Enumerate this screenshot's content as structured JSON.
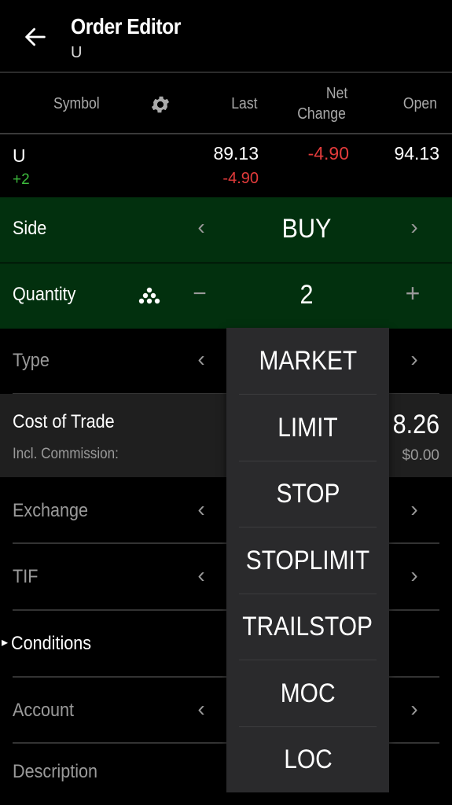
{
  "header": {
    "title": "Order Editor",
    "subtitle": "U",
    "back_icon": "arrow-left-icon"
  },
  "quote": {
    "columns": {
      "symbol": "Symbol",
      "settings_icon": "gear-icon",
      "last": "Last",
      "net_change_line1": "Net",
      "net_change_line2": "Change",
      "open": "Open"
    },
    "row": {
      "symbol": "U",
      "position": "+2",
      "last": "89.13",
      "last_change": "-4.90",
      "net_change": "-4.90",
      "open": "94.13"
    }
  },
  "form": {
    "side": {
      "label": "Side",
      "value": "BUY"
    },
    "quantity": {
      "label": "Quantity",
      "value": "2",
      "minus": "−",
      "plus": "+"
    },
    "type": {
      "label": "Type"
    },
    "cost": {
      "label": "Cost of Trade",
      "sublabel": "Incl. Commission:",
      "value_partial": "8.26",
      "commission": "$0.00"
    },
    "exchange": {
      "label": "Exchange"
    },
    "tif": {
      "label": "TIF"
    },
    "conditions": {
      "label": "Conditions",
      "icon": "▸"
    },
    "account": {
      "label": "Account"
    },
    "description": {
      "label": "Description"
    }
  },
  "chevrons": {
    "left": "‹",
    "right": "›"
  },
  "type_dropdown": {
    "options": [
      "MARKET",
      "LIMIT",
      "STOP",
      "STOPLIMIT",
      "TRAILSTOP",
      "MOC",
      "LOC"
    ]
  },
  "colors": {
    "accent_green_bg": "#02300e",
    "negative": "#e23b3b",
    "positive": "#3dbb3d"
  }
}
